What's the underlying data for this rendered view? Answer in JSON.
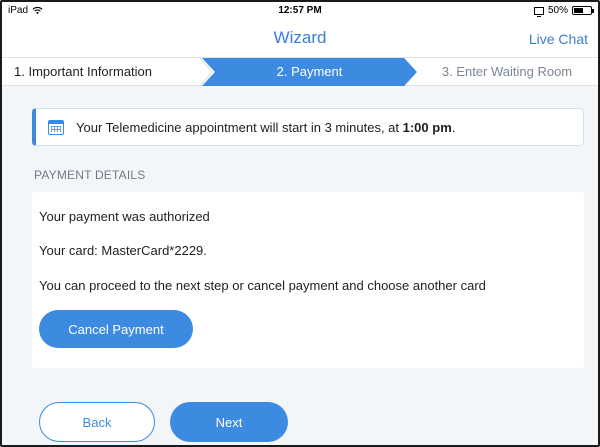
{
  "status_bar": {
    "device": "iPad",
    "time": "12:57 PM",
    "battery": "50%",
    "icons": [
      "wifi-icon",
      "screen-mirroring-icon",
      "battery-icon"
    ]
  },
  "header": {
    "title": "Wizard",
    "live_chat": "Live Chat"
  },
  "steps": [
    {
      "label": "1. Important Information",
      "state": "completed"
    },
    {
      "label": "2. Payment",
      "state": "active"
    },
    {
      "label": "3. Enter Waiting Room",
      "state": "pending"
    }
  ],
  "notice": {
    "icon": "calendar-icon",
    "text_prefix": "Your Telemedicine appointment will start in 3 minutes, at ",
    "time": "1:00 pm",
    "text_suffix": "."
  },
  "payment": {
    "section_label": "PAYMENT DETAILS",
    "authorized": "Your payment was authorized",
    "card": "Your card: MasterCard*2229.",
    "instructions": "You can proceed to the next step or cancel payment and choose another card",
    "cancel_label": "Cancel Payment"
  },
  "footer": {
    "back_label": "Back",
    "next_label": "Next"
  },
  "colors": {
    "accent": "#3d8be0",
    "background": "#f3f6f9"
  }
}
